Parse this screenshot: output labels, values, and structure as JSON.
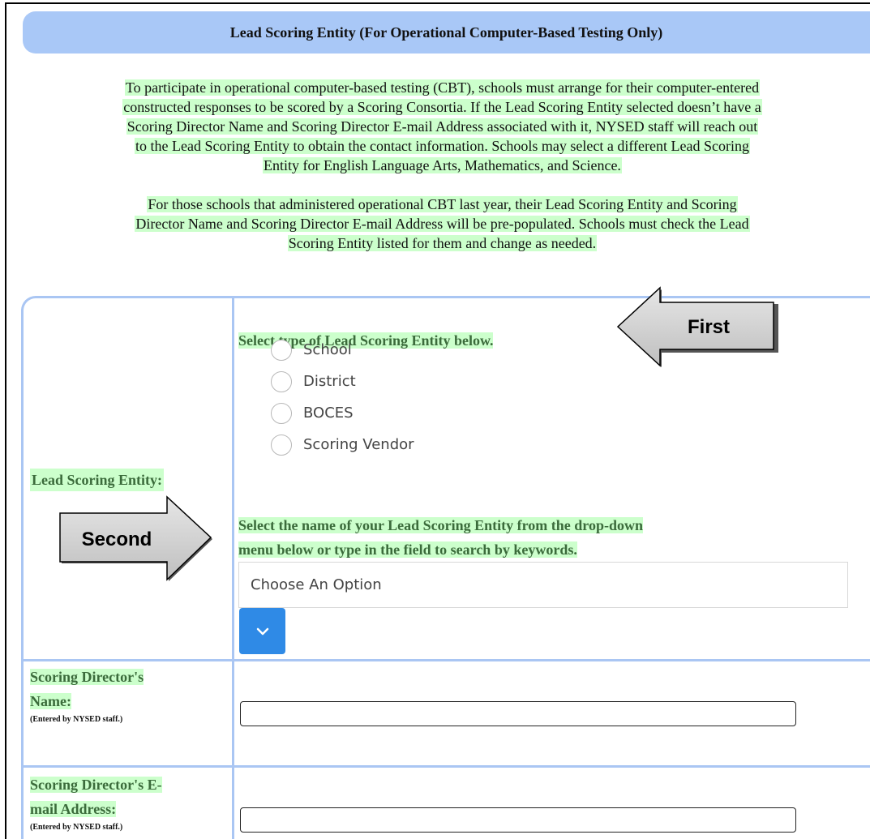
{
  "header": {
    "title": "Lead Scoring Entity (For Operational Computer-Based Testing Only)"
  },
  "intro": {
    "paragraph1_lines": [
      "To participate in operational computer-based testing (CBT), schools must arrange for their computer-entered",
      "constructed responses to be scored by a Scoring Consortia. If the Lead Scoring Entity selected doesn’t have a",
      "Scoring Director Name and Scoring Director E-mail Address associated with it, NYSED staff will reach out",
      "to the Lead Scoring Entity to obtain the contact information. Schools may select a different Lead Scoring",
      "Entity for English Language Arts, Mathematics, and Science."
    ],
    "paragraph2_lines": [
      "For those schools that administered operational CBT last year, their Lead Scoring Entity and Scoring",
      "Director Name and Scoring Director E-mail Address will be pre-populated. Schools must check the Lead",
      "Scoring Entity listed for them and change as needed."
    ]
  },
  "form": {
    "lead_scoring_label": "Lead Scoring Entity:",
    "type_instruction": "Select type of Lead Scoring Entity below.",
    "radio_options": [
      "School",
      "District",
      "BOCES",
      "Scoring Vendor"
    ],
    "name_instruction_lines": [
      "Select the name of your Lead Scoring Entity from the drop-down",
      "menu below or type in the field to search by keywords."
    ],
    "select_placeholder": "Choose An Option",
    "director_name_label_lines": [
      "Scoring Director's",
      "Name:"
    ],
    "director_name_note": "(Entered by NYSED staff.)",
    "director_name_value": "",
    "director_email_label_lines": [
      "Scoring Director's E-",
      "mail Address:"
    ],
    "director_email_note": "(Entered by NYSED staff.)",
    "director_email_value": ""
  },
  "callouts": {
    "first": "First",
    "second": "Second"
  },
  "colors": {
    "header_bg": "#a9c8f7",
    "highlight": "#ccffcc",
    "label_text": "#3b6b3b",
    "border_blue": "#aac6f3",
    "dropdown_button": "#2f8ae6"
  }
}
